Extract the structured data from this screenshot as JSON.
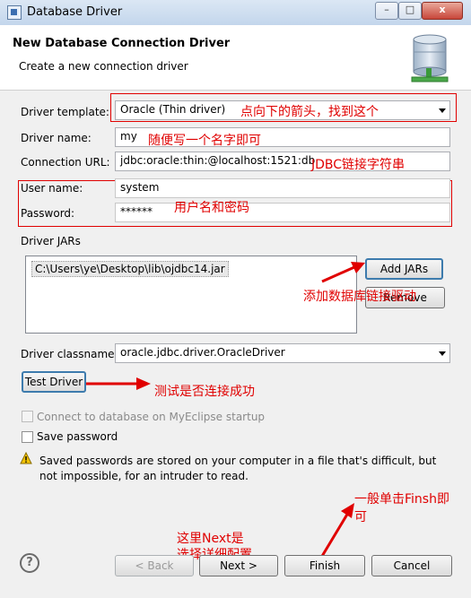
{
  "window": {
    "title": "Database Driver",
    "minimize": "–",
    "maximize": "□",
    "close": "x"
  },
  "header": {
    "title": "New Database Connection Driver",
    "subtitle": "Create a new connection driver"
  },
  "form": {
    "driver_template_label": "Driver template:",
    "driver_template_value": "Oracle (Thin driver)",
    "driver_name_label": "Driver name:",
    "driver_name_value": "my",
    "connection_url_label": "Connection URL:",
    "connection_url_value": "jdbc:oracle:thin:@localhost:1521:db",
    "user_name_label": "User name:",
    "user_name_value": "system",
    "password_label": "Password:",
    "password_value": "******",
    "driver_jars_label": "Driver JARs",
    "jars": [
      "C:\\Users\\ye\\Desktop\\lib\\ojdbc14.jar"
    ],
    "add_jars": "Add JARs",
    "remove": "Remove",
    "driver_classname_label": "Driver classname:",
    "driver_classname_value": "oracle.jdbc.driver.OracleDriver",
    "test_driver": "Test Driver",
    "connect_on_startup": "Connect to database on MyEclipse startup",
    "save_password": "Save password",
    "warning_line1": "Saved passwords are stored on your computer in a file that's difficult, but",
    "warning_line2": "not impossible, for an intruder to read."
  },
  "footer": {
    "help": "?",
    "back": "< Back",
    "next": "Next >",
    "finish": "Finish",
    "cancel": "Cancel"
  },
  "annotations": {
    "template_hint": "点向下的箭头，找到这个",
    "name_hint": "随便写一个名字即可",
    "url_hint": "JDBC链接字符串",
    "credentials_hint": "用户名和密码",
    "jar_hint": "添加数据库链接驱动",
    "test_hint": "测试是否连接成功",
    "finish_hint_1": "一般单击Finsh即",
    "finish_hint_2": "可",
    "next_hint_1": "这里Next是",
    "next_hint_2": "选择详细配置"
  },
  "colors": {
    "annotation": "#e00000",
    "background": "#f0f0f0",
    "focus_border": "#3d7bad"
  }
}
